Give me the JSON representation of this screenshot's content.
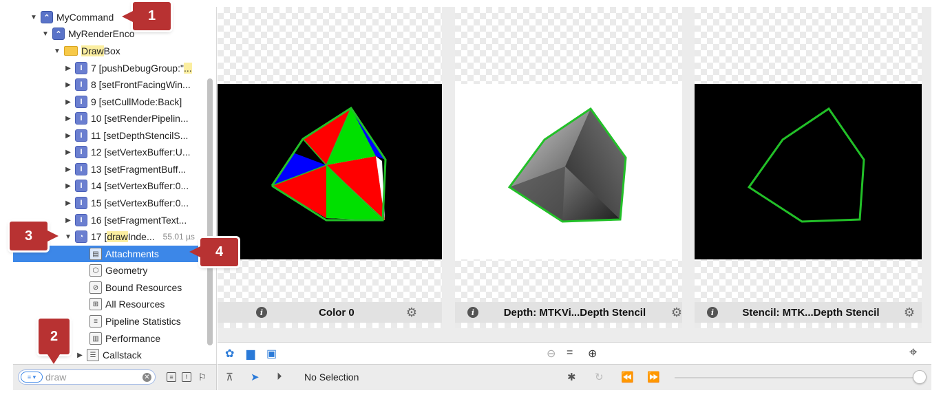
{
  "navigator": {
    "rows": [
      {
        "label": "MyCommand",
        "icon": "command-buffer-icon"
      },
      {
        "label": "MyRenderEnco",
        "icon": "render-encoder-icon"
      },
      {
        "label_pre": "",
        "label_hl": "Draw",
        "label_post": "Box",
        "icon": "folder-icon"
      },
      {
        "label": "7 [pushDebugGroup:\"",
        "label_hl": "...",
        "icon": "api-call-icon"
      },
      {
        "label": "8 [setFrontFacingWin...",
        "icon": "api-call-icon"
      },
      {
        "label": "9 [setCullMode:Back]",
        "icon": "api-call-icon"
      },
      {
        "label": "10 [setRenderPipelin...",
        "icon": "api-call-icon"
      },
      {
        "label": "11 [setDepthStencilS...",
        "icon": "api-call-icon"
      },
      {
        "label": "12 [setVertexBuffer:U...",
        "icon": "api-call-icon"
      },
      {
        "label": "13 [setFragmentBuff...",
        "icon": "api-call-icon"
      },
      {
        "label": "14 [setVertexBuffer:0...",
        "icon": "api-call-icon"
      },
      {
        "label": "15 [setVertexBuffer:0...",
        "icon": "api-call-icon"
      },
      {
        "label": "16 [setFragmentText...",
        "icon": "api-call-icon"
      },
      {
        "label_pre": "17 [",
        "label_hl": "draw",
        "label_post": "Inde...",
        "time": "55.01 µs",
        "icon": "draw-call-icon"
      },
      {
        "label": "Attachments",
        "icon": "attachments-icon"
      },
      {
        "label": "Geometry",
        "icon": "geometry-icon"
      },
      {
        "label": "Bound Resources",
        "icon": "bound-resources-icon"
      },
      {
        "label": "All Resources",
        "icon": "all-resources-icon"
      },
      {
        "label": "Pipeline Statistics",
        "icon": "pipeline-statistics-icon"
      },
      {
        "label": "Performance",
        "icon": "performance-icon"
      },
      {
        "label": "Callstack",
        "icon": "callstack-icon"
      }
    ]
  },
  "filter": {
    "value": "draw"
  },
  "panels": [
    {
      "caption": "Color 0"
    },
    {
      "caption": "Depth: MTKVi...Depth Stencil"
    },
    {
      "caption": "Stencil: MTK...Depth Stencil"
    }
  ],
  "debugbar": {
    "selection": "No Selection"
  },
  "callouts": [
    "1",
    "2",
    "3",
    "4"
  ],
  "colors": {
    "accent": "#3c87e8",
    "callout": "#b83232",
    "outline": "#22c028"
  }
}
